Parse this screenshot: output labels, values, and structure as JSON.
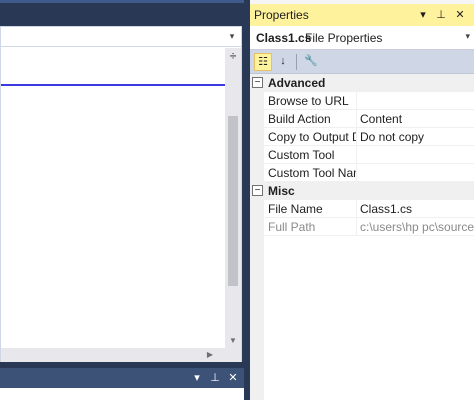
{
  "properties_window": {
    "title": "Properties",
    "controls": {
      "dropdown": "▾",
      "pin": "⊥",
      "close": "✕"
    },
    "object_selector": {
      "name": "Class1.cs",
      "type": "File Properties",
      "dropdown": "▾"
    },
    "toolbar": {
      "categorized": "☷",
      "alphabetical": "↓",
      "property_pages": "🔧"
    },
    "categories": [
      {
        "label": "Advanced",
        "expander": "−",
        "properties": [
          {
            "name": "Browse to URL",
            "value": ""
          },
          {
            "name": "Build Action",
            "value": "Content"
          },
          {
            "name": "Copy to Output Directory",
            "value": "Do not copy"
          },
          {
            "name": "Custom Tool",
            "value": ""
          },
          {
            "name": "Custom Tool Namespace",
            "value": ""
          }
        ]
      },
      {
        "label": "Misc",
        "expander": "−",
        "properties": [
          {
            "name": "File Name",
            "value": "Class1.cs"
          },
          {
            "name": "Full Path",
            "value": "c:\\users\\hp pc\\source\\repos"
          }
        ]
      }
    ]
  },
  "editor": {
    "split_icon": "÷",
    "nav_dropdown": "▾",
    "scroll_down": "▼",
    "scroll_right": "▶"
  },
  "bottom_panel": {
    "dropdown": "▾",
    "pin": "⊥",
    "close": "✕"
  },
  "colors": {
    "title_active": "#fff29d",
    "chrome": "#293955",
    "toolbar": "#cfd6e5"
  }
}
